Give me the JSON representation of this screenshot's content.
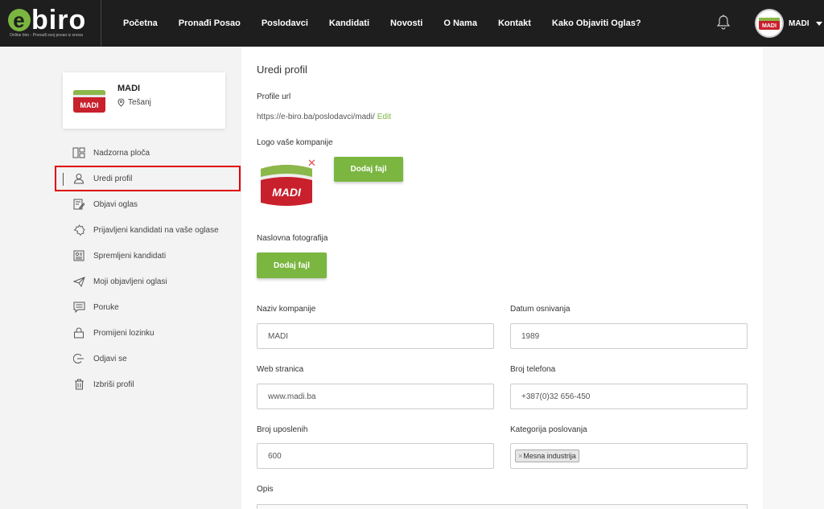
{
  "brand": {
    "logo_text": "biro",
    "logo_letter": "e",
    "tagline": "Online biro - Pronađi svoj posao iz snova",
    "accent": "#7ab640"
  },
  "nav": {
    "items": [
      {
        "label": "Početna"
      },
      {
        "label": "Pronađi Posao"
      },
      {
        "label": "Poslodavci"
      },
      {
        "label": "Kandidati"
      },
      {
        "label": "Novosti"
      },
      {
        "label": "O Nama"
      },
      {
        "label": "Kontakt"
      },
      {
        "label": "Kako Objaviti Oglas?"
      }
    ],
    "notification_icon": "bell-icon",
    "user_name": "MADI"
  },
  "profile_card": {
    "name": "MADI",
    "location": "Tešanj"
  },
  "sidebar": {
    "items": [
      {
        "label": "Nadzorna ploča",
        "icon": "dashboard-icon"
      },
      {
        "label": "Uredi profil",
        "icon": "user-icon"
      },
      {
        "label": "Objavi oglas",
        "icon": "edit-document-icon"
      },
      {
        "label": "Prijavljeni kandidati na vaše oglase",
        "icon": "badge-icon"
      },
      {
        "label": "Spremljeni kandidati",
        "icon": "saved-profiles-icon"
      },
      {
        "label": "Moji objavljeni oglasi",
        "icon": "paper-plane-icon"
      },
      {
        "label": "Poruke",
        "icon": "message-icon"
      },
      {
        "label": "Promijeni lozinku",
        "icon": "lock-icon"
      },
      {
        "label": "Odjavi se",
        "icon": "logout-icon"
      },
      {
        "label": "Izbriši profil",
        "icon": "trash-icon"
      }
    ],
    "active_index": 1
  },
  "form": {
    "title": "Uredi profil",
    "profile_url_label": "Profile url",
    "profile_url": "https://e-biro.ba/poslodavci/madi/",
    "edit_label": "Edit",
    "logo_label": "Logo vaše kompanije",
    "add_file_label": "Dodaj fajl",
    "cover_label": "Naslovna fotografija",
    "company_name_label": "Naziv kompanije",
    "company_name": "MADI",
    "founded_label": "Datum osnivanja",
    "founded": "1989",
    "website_label": "Web stranica",
    "website": "www.madi.ba",
    "phone_label": "Broj telefona",
    "phone": "+387(0)32 656-450",
    "employees_label": "Broj uposlenih",
    "employees": "600",
    "category_label": "Kategorija poslovanja",
    "category_tag": "Mesna industrija",
    "description_label": "Opis"
  }
}
